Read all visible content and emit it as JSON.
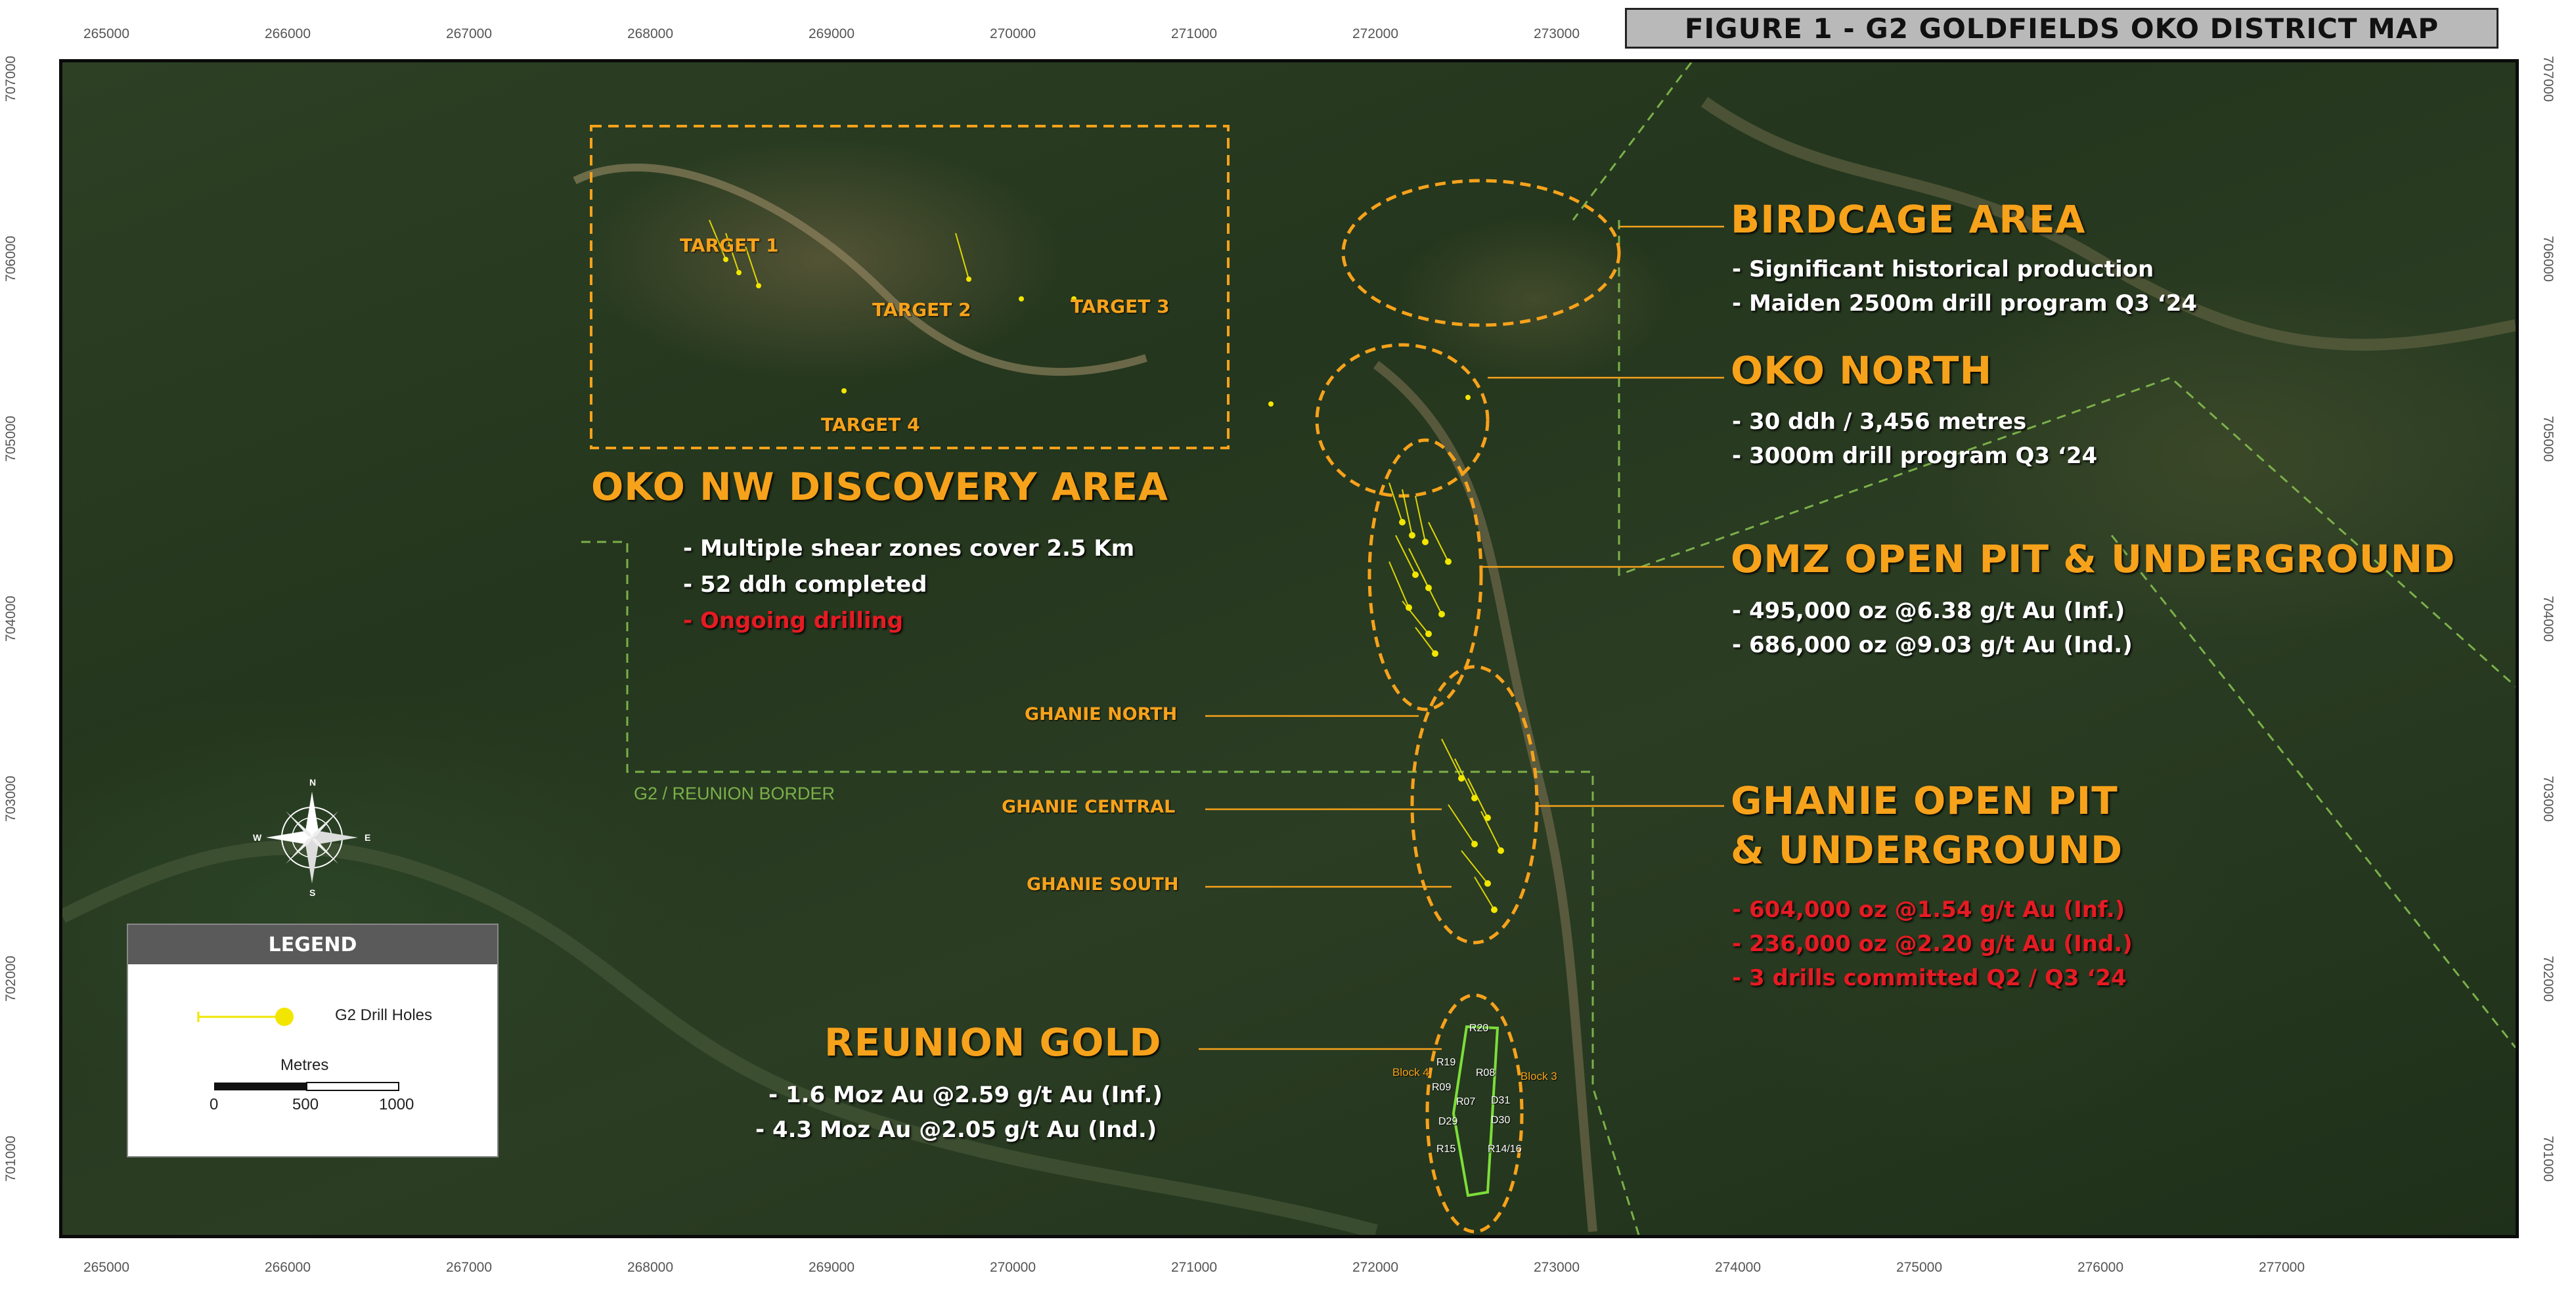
{
  "title": "FIGURE 1 - G2 GOLDFIELDS OKO DISTRICT MAP",
  "ticks": {
    "x": [
      "265000",
      "266000",
      "267000",
      "268000",
      "269000",
      "270000",
      "271000",
      "272000",
      "273000",
      "274000",
      "275000",
      "276000",
      "277000"
    ],
    "y": [
      "707000",
      "706000",
      "705000",
      "704000",
      "703000",
      "702000",
      "701000"
    ]
  },
  "targets": [
    "TARGET 1",
    "TARGET 2",
    "TARGET 3",
    "TARGET 4"
  ],
  "oko_nw": {
    "heading": "OKO NW DISCOVERY AREA",
    "bullets": [
      "-  Multiple shear zones cover 2.5 Km",
      "- 52 ddh completed"
    ],
    "bullet_red": "- Ongoing drilling"
  },
  "birdcage": {
    "heading": "BIRDCAGE AREA",
    "bullets": [
      "-  Significant historical production",
      "-  Maiden 2500m drill program Q3 ‘24"
    ]
  },
  "oko_north": {
    "heading": "OKO NORTH",
    "bullets": [
      "-  30 ddh / 3,456 metres",
      "- 3000m drill program Q3 ‘24"
    ]
  },
  "omz": {
    "heading": "OMZ OPEN PIT & UNDERGROUND",
    "bullets": [
      "- 495,000 oz @6.38 g/t Au (Inf.)",
      "- 686,000 oz @9.03 g/t Au (Ind.)"
    ]
  },
  "ghanie": {
    "heading_line1": "GHANIE OPEN PIT",
    "heading_line2": "& UNDERGROUND",
    "bullets_red": [
      "- 604,000 oz @1.54 g/t Au (Inf.)",
      "- 236,000 oz @2.20 g/t Au (Ind.)",
      "- 3 drills committed Q2 / Q3 ‘24"
    ]
  },
  "ghanie_zones": [
    "GHANIE NORTH",
    "GHANIE CENTRAL",
    "GHANIE SOUTH"
  ],
  "reunion": {
    "heading": "REUNION GOLD",
    "bullets": [
      "- 1.6 Moz Au @2.59 g/t Au (Inf.)",
      "- 4.3 Moz Au @2.05 g/t Au (Ind.)"
    ],
    "blocks": [
      "Block 4",
      "Block 3"
    ],
    "holes": [
      "R20",
      "R19",
      "R08",
      "R09",
      "R07",
      "D31",
      "D29",
      "D30",
      "R15",
      "R14/16"
    ]
  },
  "border_label": "G2 / REUNION BORDER",
  "compass": {
    "n": "N",
    "s": "S",
    "e": "E",
    "w": "W"
  },
  "legend": {
    "title": "LEGEND",
    "item": "G2 Drill Holes",
    "scale_title": "Metres",
    "scale_labels": [
      "0",
      "500",
      "1000"
    ]
  },
  "colors": {
    "accent": "#f7a21b",
    "red": "#e51b23",
    "border": "#7bb04a",
    "drill": "#f2e600"
  }
}
